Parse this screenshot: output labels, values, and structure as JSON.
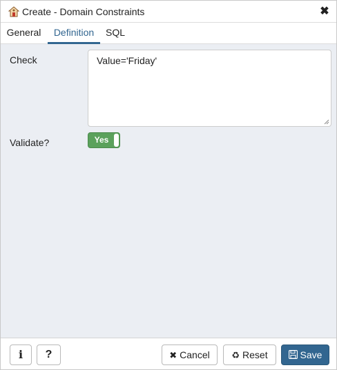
{
  "dialog": {
    "title": "Create - Domain Constraints",
    "title_icon": "domain-constraint-icon",
    "close_icon": "close-icon"
  },
  "tabs": [
    {
      "label": "General",
      "active": false
    },
    {
      "label": "Definition",
      "active": true
    },
    {
      "label": "SQL",
      "active": false
    }
  ],
  "form": {
    "check_label": "Check",
    "check_value": "Value='Friday'",
    "validate_label": "Validate?",
    "validate_value": "Yes",
    "validate_on": true
  },
  "footer": {
    "info_label": "i",
    "help_label": "?",
    "cancel_label": "Cancel",
    "cancel_icon": "times-icon",
    "reset_label": "Reset",
    "reset_icon": "recycle-icon",
    "save_label": "Save",
    "save_icon": "floppy-icon"
  },
  "colors": {
    "accent": "#326690",
    "toggle_on": "#5ba15c",
    "body_bg": "#ebeef3"
  }
}
